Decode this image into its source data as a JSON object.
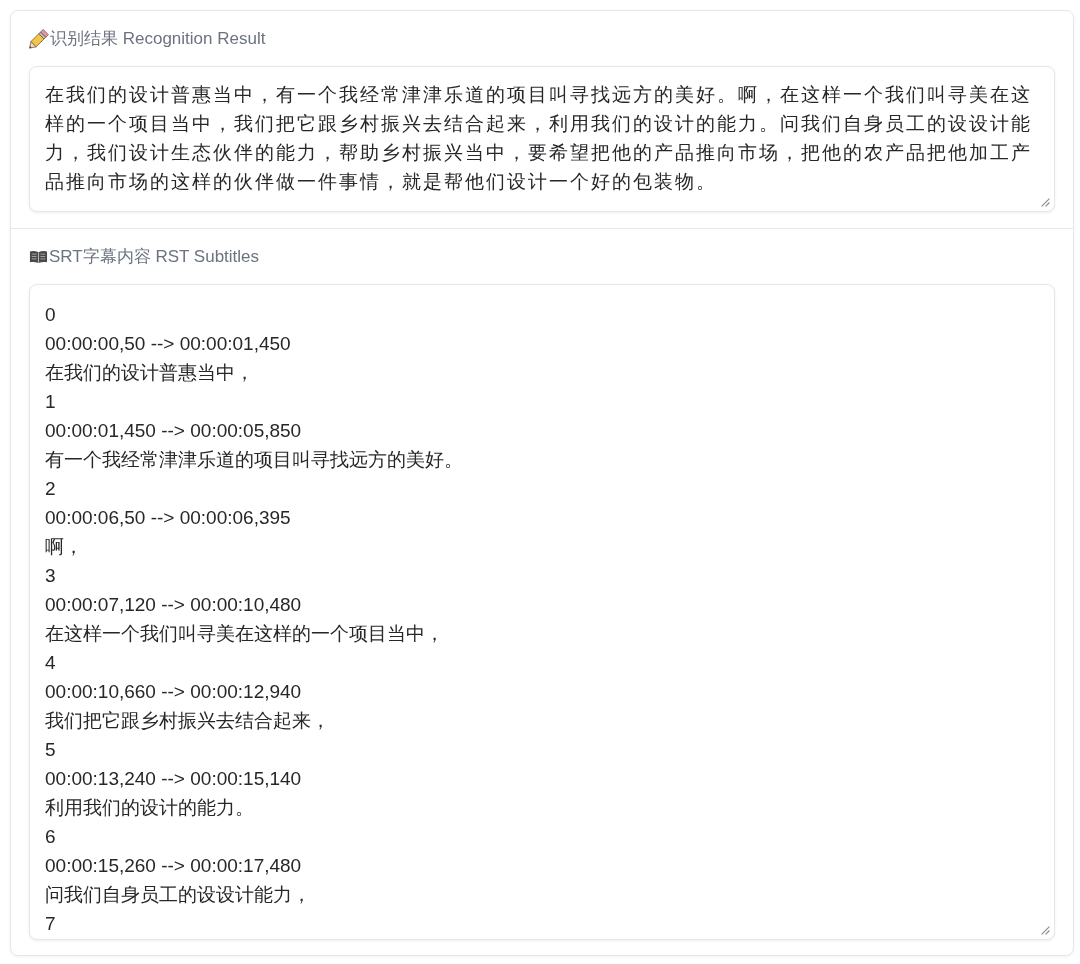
{
  "sections": [
    {
      "kind": "result",
      "label": "识别结果 Recognition Result",
      "value": "在我们的设计普惠当中，有一个我经常津津乐道的项目叫寻找远方的美好。啊，在这样一个我们叫寻美在这样的一个项目当中，我们把它跟乡村振兴去结合起来，利用我们的设计的能力。问我们自身员工的设设计能力，我们设计生态伙伴的能力，帮助乡村振兴当中，要希望把他的产品推向市场，把他的农产品把他加工产品推向市场的这样的伙伴做一件事情，就是帮他们设计一个好的包装物。"
    },
    {
      "kind": "subtitles",
      "label": "SRT字幕内容 RST Subtitles",
      "value": "0\n00:00:00,50 --> 00:00:01,450\n在我们的设计普惠当中，\n1\n00:00:01,450 --> 00:00:05,850\n有一个我经常津津乐道的项目叫寻找远方的美好。\n2\n00:00:06,50 --> 00:00:06,395\n啊，\n3\n00:00:07,120 --> 00:00:10,480\n在这样一个我们叫寻美在这样的一个项目当中，\n4\n00:00:10,660 --> 00:00:12,940\n我们把它跟乡村振兴去结合起来，\n5\n00:00:13,240 --> 00:00:15,140\n利用我们的设计的能力。\n6\n00:00:15,260 --> 00:00:17,480\n问我们自身员工的设设计能力，\n7"
    }
  ]
}
